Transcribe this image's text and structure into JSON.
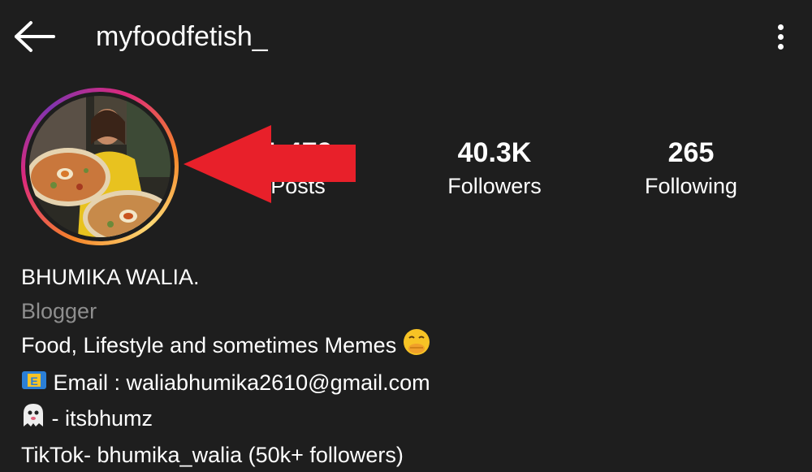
{
  "header": {
    "username": "myfoodfetish_",
    "back_icon": "arrow-left-icon",
    "more_icon": "more-vertical-icon"
  },
  "profile": {
    "avatar_icon": "profile-photo",
    "ring_colors": [
      "#f58529",
      "#dd2a7b",
      "#8134af",
      "#feda75"
    ]
  },
  "stats": {
    "posts": {
      "count": "1,479",
      "label": "Posts"
    },
    "followers": {
      "count": "40.3K",
      "label": "Followers"
    },
    "following": {
      "count": "265",
      "label": "Following"
    }
  },
  "bio": {
    "name": "BHUMIKA WALIA.",
    "category": "Blogger",
    "line1": "Food, Lifestyle and sometimes Memes",
    "line1_emoji": "hand-over-mouth-emoji",
    "email": "Email : waliabhumika2610@gmail.com",
    "email_emoji": "e-mail-emoji",
    "snap": "- itsbhumz",
    "snap_emoji": "ghost-emoji",
    "tiktok": "TikTok- bhumika_walia (50k+ followers)"
  },
  "annotation": {
    "arrow_color": "#e8202a"
  }
}
